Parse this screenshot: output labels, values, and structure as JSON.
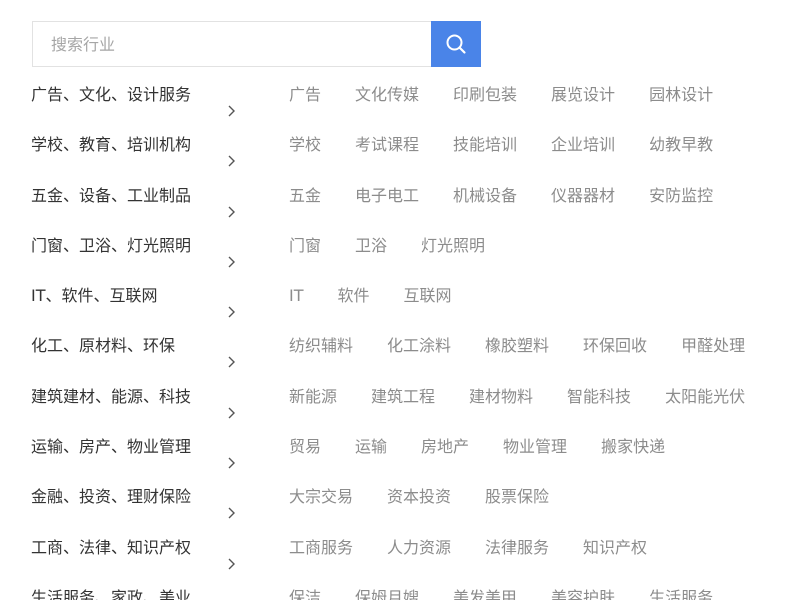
{
  "search": {
    "placeholder": "搜索行业"
  },
  "categories": [
    {
      "label": "广告、文化、设计服务",
      "items": [
        "广告",
        "文化传媒",
        "印刷包装",
        "展览设计",
        "园林设计"
      ]
    },
    {
      "label": "学校、教育、培训机构",
      "items": [
        "学校",
        "考试课程",
        "技能培训",
        "企业培训",
        "幼教早教"
      ]
    },
    {
      "label": "五金、设备、工业制品",
      "items": [
        "五金",
        "电子电工",
        "机械设备",
        "仪器器材",
        "安防监控"
      ]
    },
    {
      "label": "门窗、卫浴、灯光照明",
      "items": [
        "门窗",
        "卫浴",
        "灯光照明"
      ]
    },
    {
      "label": "IT、软件、互联网",
      "items": [
        "IT",
        "软件",
        "互联网"
      ]
    },
    {
      "label": "化工、原材料、环保",
      "items": [
        "纺织辅料",
        "化工涂料",
        "橡胶塑料",
        "环保回收",
        "甲醛处理"
      ]
    },
    {
      "label": "建筑建材、能源、科技",
      "items": [
        "新能源",
        "建筑工程",
        "建材物料",
        "智能科技",
        "太阳能光伏"
      ]
    },
    {
      "label": "运输、房产、物业管理",
      "items": [
        "贸易",
        "运输",
        "房地产",
        "物业管理",
        "搬家快递"
      ]
    },
    {
      "label": "金融、投资、理财保险",
      "items": [
        "大宗交易",
        "资本投资",
        "股票保险"
      ]
    },
    {
      "label": "工商、法律、知识产权",
      "items": [
        "工商服务",
        "人力资源",
        "法律服务",
        "知识产权"
      ]
    },
    {
      "label": "生活服务、家政、美业",
      "items": [
        "保洁",
        "保姆月嫂",
        "美发美甲",
        "美容护肤",
        "生活服务"
      ]
    }
  ],
  "colors": {
    "accent": "#4a84e8",
    "category_text": "#333333",
    "sub_text": "#8c8c8c"
  }
}
